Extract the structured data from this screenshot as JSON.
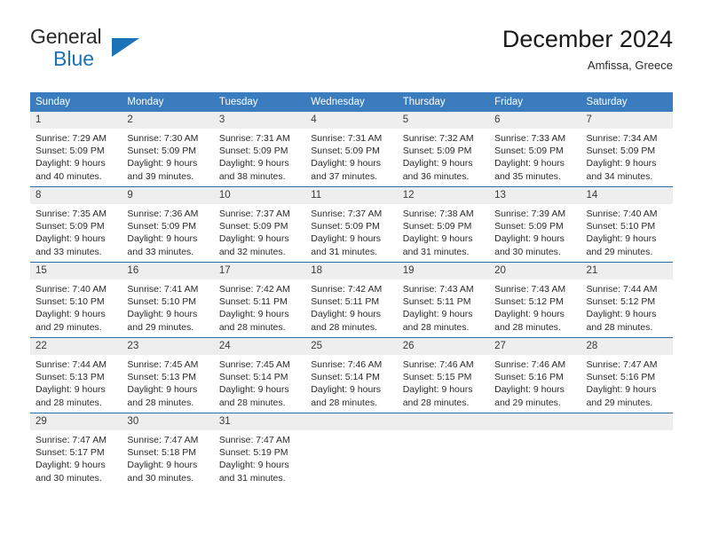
{
  "brand": {
    "name_primary": "General",
    "name_secondary": "Blue",
    "triangle_color": "#1c72b8"
  },
  "header": {
    "title": "December 2024",
    "subtitle": "Amfissa, Greece"
  },
  "theme": {
    "header_bg": "#3a7cbe",
    "row_divider": "#2e6da4",
    "daynum_bg": "#eeeeee"
  },
  "calendar": {
    "weekday_headers": [
      "Sunday",
      "Monday",
      "Tuesday",
      "Wednesday",
      "Thursday",
      "Friday",
      "Saturday"
    ],
    "weeks": [
      [
        {
          "day": "1",
          "sunrise": "Sunrise: 7:29 AM",
          "sunset": "Sunset: 5:09 PM",
          "daylight_line1": "Daylight: 9 hours",
          "daylight_line2": "and 40 minutes."
        },
        {
          "day": "2",
          "sunrise": "Sunrise: 7:30 AM",
          "sunset": "Sunset: 5:09 PM",
          "daylight_line1": "Daylight: 9 hours",
          "daylight_line2": "and 39 minutes."
        },
        {
          "day": "3",
          "sunrise": "Sunrise: 7:31 AM",
          "sunset": "Sunset: 5:09 PM",
          "daylight_line1": "Daylight: 9 hours",
          "daylight_line2": "and 38 minutes."
        },
        {
          "day": "4",
          "sunrise": "Sunrise: 7:31 AM",
          "sunset": "Sunset: 5:09 PM",
          "daylight_line1": "Daylight: 9 hours",
          "daylight_line2": "and 37 minutes."
        },
        {
          "day": "5",
          "sunrise": "Sunrise: 7:32 AM",
          "sunset": "Sunset: 5:09 PM",
          "daylight_line1": "Daylight: 9 hours",
          "daylight_line2": "and 36 minutes."
        },
        {
          "day": "6",
          "sunrise": "Sunrise: 7:33 AM",
          "sunset": "Sunset: 5:09 PM",
          "daylight_line1": "Daylight: 9 hours",
          "daylight_line2": "and 35 minutes."
        },
        {
          "day": "7",
          "sunrise": "Sunrise: 7:34 AM",
          "sunset": "Sunset: 5:09 PM",
          "daylight_line1": "Daylight: 9 hours",
          "daylight_line2": "and 34 minutes."
        }
      ],
      [
        {
          "day": "8",
          "sunrise": "Sunrise: 7:35 AM",
          "sunset": "Sunset: 5:09 PM",
          "daylight_line1": "Daylight: 9 hours",
          "daylight_line2": "and 33 minutes."
        },
        {
          "day": "9",
          "sunrise": "Sunrise: 7:36 AM",
          "sunset": "Sunset: 5:09 PM",
          "daylight_line1": "Daylight: 9 hours",
          "daylight_line2": "and 33 minutes."
        },
        {
          "day": "10",
          "sunrise": "Sunrise: 7:37 AM",
          "sunset": "Sunset: 5:09 PM",
          "daylight_line1": "Daylight: 9 hours",
          "daylight_line2": "and 32 minutes."
        },
        {
          "day": "11",
          "sunrise": "Sunrise: 7:37 AM",
          "sunset": "Sunset: 5:09 PM",
          "daylight_line1": "Daylight: 9 hours",
          "daylight_line2": "and 31 minutes."
        },
        {
          "day": "12",
          "sunrise": "Sunrise: 7:38 AM",
          "sunset": "Sunset: 5:09 PM",
          "daylight_line1": "Daylight: 9 hours",
          "daylight_line2": "and 31 minutes."
        },
        {
          "day": "13",
          "sunrise": "Sunrise: 7:39 AM",
          "sunset": "Sunset: 5:09 PM",
          "daylight_line1": "Daylight: 9 hours",
          "daylight_line2": "and 30 minutes."
        },
        {
          "day": "14",
          "sunrise": "Sunrise: 7:40 AM",
          "sunset": "Sunset: 5:10 PM",
          "daylight_line1": "Daylight: 9 hours",
          "daylight_line2": "and 29 minutes."
        }
      ],
      [
        {
          "day": "15",
          "sunrise": "Sunrise: 7:40 AM",
          "sunset": "Sunset: 5:10 PM",
          "daylight_line1": "Daylight: 9 hours",
          "daylight_line2": "and 29 minutes."
        },
        {
          "day": "16",
          "sunrise": "Sunrise: 7:41 AM",
          "sunset": "Sunset: 5:10 PM",
          "daylight_line1": "Daylight: 9 hours",
          "daylight_line2": "and 29 minutes."
        },
        {
          "day": "17",
          "sunrise": "Sunrise: 7:42 AM",
          "sunset": "Sunset: 5:11 PM",
          "daylight_line1": "Daylight: 9 hours",
          "daylight_line2": "and 28 minutes."
        },
        {
          "day": "18",
          "sunrise": "Sunrise: 7:42 AM",
          "sunset": "Sunset: 5:11 PM",
          "daylight_line1": "Daylight: 9 hours",
          "daylight_line2": "and 28 minutes."
        },
        {
          "day": "19",
          "sunrise": "Sunrise: 7:43 AM",
          "sunset": "Sunset: 5:11 PM",
          "daylight_line1": "Daylight: 9 hours",
          "daylight_line2": "and 28 minutes."
        },
        {
          "day": "20",
          "sunrise": "Sunrise: 7:43 AM",
          "sunset": "Sunset: 5:12 PM",
          "daylight_line1": "Daylight: 9 hours",
          "daylight_line2": "and 28 minutes."
        },
        {
          "day": "21",
          "sunrise": "Sunrise: 7:44 AM",
          "sunset": "Sunset: 5:12 PM",
          "daylight_line1": "Daylight: 9 hours",
          "daylight_line2": "and 28 minutes."
        }
      ],
      [
        {
          "day": "22",
          "sunrise": "Sunrise: 7:44 AM",
          "sunset": "Sunset: 5:13 PM",
          "daylight_line1": "Daylight: 9 hours",
          "daylight_line2": "and 28 minutes."
        },
        {
          "day": "23",
          "sunrise": "Sunrise: 7:45 AM",
          "sunset": "Sunset: 5:13 PM",
          "daylight_line1": "Daylight: 9 hours",
          "daylight_line2": "and 28 minutes."
        },
        {
          "day": "24",
          "sunrise": "Sunrise: 7:45 AM",
          "sunset": "Sunset: 5:14 PM",
          "daylight_line1": "Daylight: 9 hours",
          "daylight_line2": "and 28 minutes."
        },
        {
          "day": "25",
          "sunrise": "Sunrise: 7:46 AM",
          "sunset": "Sunset: 5:14 PM",
          "daylight_line1": "Daylight: 9 hours",
          "daylight_line2": "and 28 minutes."
        },
        {
          "day": "26",
          "sunrise": "Sunrise: 7:46 AM",
          "sunset": "Sunset: 5:15 PM",
          "daylight_line1": "Daylight: 9 hours",
          "daylight_line2": "and 28 minutes."
        },
        {
          "day": "27",
          "sunrise": "Sunrise: 7:46 AM",
          "sunset": "Sunset: 5:16 PM",
          "daylight_line1": "Daylight: 9 hours",
          "daylight_line2": "and 29 minutes."
        },
        {
          "day": "28",
          "sunrise": "Sunrise: 7:47 AM",
          "sunset": "Sunset: 5:16 PM",
          "daylight_line1": "Daylight: 9 hours",
          "daylight_line2": "and 29 minutes."
        }
      ],
      [
        {
          "day": "29",
          "sunrise": "Sunrise: 7:47 AM",
          "sunset": "Sunset: 5:17 PM",
          "daylight_line1": "Daylight: 9 hours",
          "daylight_line2": "and 30 minutes."
        },
        {
          "day": "30",
          "sunrise": "Sunrise: 7:47 AM",
          "sunset": "Sunset: 5:18 PM",
          "daylight_line1": "Daylight: 9 hours",
          "daylight_line2": "and 30 minutes."
        },
        {
          "day": "31",
          "sunrise": "Sunrise: 7:47 AM",
          "sunset": "Sunset: 5:19 PM",
          "daylight_line1": "Daylight: 9 hours",
          "daylight_line2": "and 31 minutes."
        },
        {
          "day": "",
          "sunrise": "",
          "sunset": "",
          "daylight_line1": "",
          "daylight_line2": ""
        },
        {
          "day": "",
          "sunrise": "",
          "sunset": "",
          "daylight_line1": "",
          "daylight_line2": ""
        },
        {
          "day": "",
          "sunrise": "",
          "sunset": "",
          "daylight_line1": "",
          "daylight_line2": ""
        },
        {
          "day": "",
          "sunrise": "",
          "sunset": "",
          "daylight_line1": "",
          "daylight_line2": ""
        }
      ]
    ]
  }
}
